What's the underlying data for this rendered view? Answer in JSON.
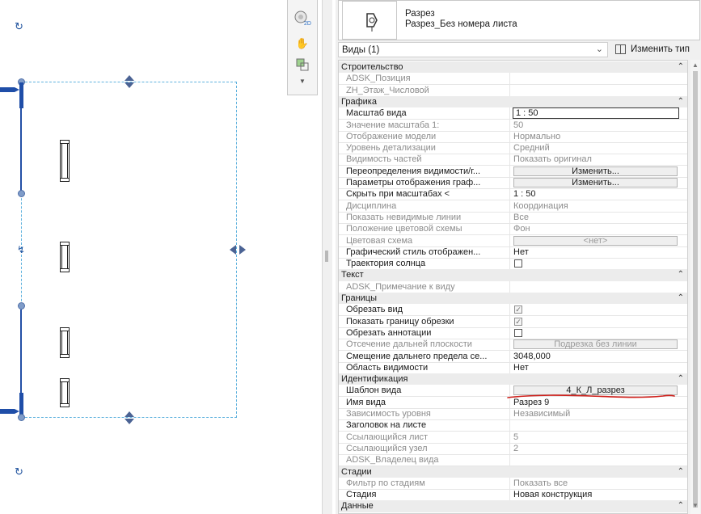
{
  "type_selector": {
    "family": "Разрез",
    "type": "Разрез_Без номера листа",
    "instance_dropdown": "Виды (1)",
    "edit_type_label": "Изменить тип"
  },
  "canvas_tools": {
    "icons": [
      "view-cube-2d-icon",
      "pan-hand-icon",
      "zoom-region-icon",
      "more-options-icon"
    ]
  },
  "groups": [
    {
      "label": "Строительство",
      "rows": [
        {
          "name": "ADSK_Позиция",
          "value": "",
          "kind": "text",
          "disabled": true
        },
        {
          "name": "ZH_Этаж_Числовой",
          "value": "",
          "kind": "text",
          "disabled": true
        }
      ]
    },
    {
      "label": "Графика",
      "rows": [
        {
          "name": "Масштаб вида",
          "value": "1 : 50",
          "kind": "input",
          "disabled": false
        },
        {
          "name": "Значение масштаба    1:",
          "value": "50",
          "kind": "text",
          "disabled": true
        },
        {
          "name": "Отображение модели",
          "value": "Нормально",
          "kind": "text",
          "disabled": true
        },
        {
          "name": "Уровень детализации",
          "value": "Средний",
          "kind": "text",
          "disabled": true
        },
        {
          "name": "Видимость частей",
          "value": "Показать оригинал",
          "kind": "text",
          "disabled": true
        },
        {
          "name": "Переопределения видимости/г...",
          "value": "Изменить...",
          "kind": "button",
          "disabled": false
        },
        {
          "name": "Параметры отображения граф...",
          "value": "Изменить...",
          "kind": "button",
          "disabled": false
        },
        {
          "name": "Скрыть при масштабах <",
          "value": "1 : 50",
          "kind": "text",
          "disabled": false
        },
        {
          "name": "Дисциплина",
          "value": "Координация",
          "kind": "text",
          "disabled": true
        },
        {
          "name": "Показать невидимые линии",
          "value": "Все",
          "kind": "text",
          "disabled": true
        },
        {
          "name": "Положение цветовой схемы",
          "value": "Фон",
          "kind": "text",
          "disabled": true
        },
        {
          "name": "Цветовая схема",
          "value": "<нет>",
          "kind": "button",
          "disabled": true
        },
        {
          "name": "Графический стиль отображен...",
          "value": "Нет",
          "kind": "text",
          "disabled": false
        },
        {
          "name": "Траектория солнца",
          "value": "",
          "kind": "checkbox",
          "checked": false,
          "disabled": false
        }
      ]
    },
    {
      "label": "Текст",
      "rows": [
        {
          "name": "ADSK_Примечание к виду",
          "value": "",
          "kind": "text",
          "disabled": true
        }
      ]
    },
    {
      "label": "Границы",
      "rows": [
        {
          "name": "Обрезать вид",
          "value": "",
          "kind": "checkbox",
          "checked": true,
          "disabled": false,
          "check_disabled": true
        },
        {
          "name": "Показать границу обрезки",
          "value": "",
          "kind": "checkbox",
          "checked": true,
          "disabled": false,
          "check_disabled": true
        },
        {
          "name": "Обрезать аннотации",
          "value": "",
          "kind": "checkbox",
          "checked": false,
          "disabled": false
        },
        {
          "name": "Отсечение дальней плоскости",
          "value": "Подрезка без линии",
          "kind": "button",
          "disabled": true
        },
        {
          "name": "Смещение дальнего предела се...",
          "value": "3048,000",
          "kind": "text",
          "disabled": false
        },
        {
          "name": "Область видимости",
          "value": "Нет",
          "kind": "text",
          "disabled": false
        }
      ]
    },
    {
      "label": "Идентификация",
      "rows": [
        {
          "name": "Шаблон вида",
          "value": "4_К_Л_разрез",
          "kind": "button",
          "disabled": false
        },
        {
          "name": "Имя вида",
          "value": "Разрез 9",
          "kind": "text",
          "disabled": false
        },
        {
          "name": "Зависимость уровня",
          "value": "Независимый",
          "kind": "text",
          "disabled": true
        },
        {
          "name": "Заголовок на листе",
          "value": "",
          "kind": "text",
          "disabled": false
        },
        {
          "name": "Ссылающийся лист",
          "value": "5",
          "kind": "text",
          "disabled": true
        },
        {
          "name": "Ссылающийся узел",
          "value": "2",
          "kind": "text",
          "disabled": true
        },
        {
          "name": "ADSK_Владелец вида",
          "value": "",
          "kind": "text",
          "disabled": true
        }
      ]
    },
    {
      "label": "Стадии",
      "rows": [
        {
          "name": "Фильтр по стадиям",
          "value": "Показать все",
          "kind": "text",
          "disabled": true
        },
        {
          "name": "Стадия",
          "value": "Новая конструкция",
          "kind": "text",
          "disabled": false
        }
      ]
    },
    {
      "label": "Данные",
      "rows": []
    }
  ],
  "colors": {
    "annotation_underline": "#d0211c",
    "section_blue": "#1f4ea8",
    "crop_boundary": "#5fb2de"
  }
}
